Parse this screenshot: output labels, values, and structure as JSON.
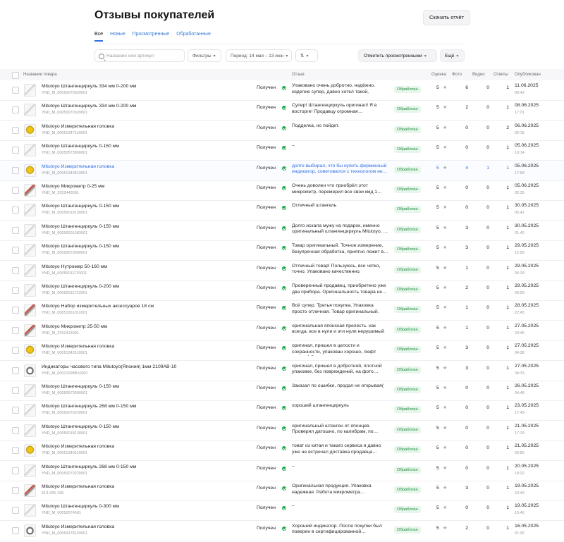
{
  "page": {
    "title": "Отзывы покупателей",
    "download_label": "Скачать отчёт",
    "tabs": [
      {
        "label": "Все",
        "active": true
      },
      {
        "label": "Новые",
        "active": false
      },
      {
        "label": "Просмотренные",
        "active": false
      },
      {
        "label": "Обработанные",
        "active": false
      }
    ]
  },
  "toolbar": {
    "search_placeholder": "Название или артикул",
    "filters_label": "Фильтры",
    "period_label": "Период: 14 мая – 13 июн",
    "mark_label": "Отметить просмотренными",
    "more_label": "Ещё"
  },
  "table": {
    "headers": {
      "product": "Название товара",
      "review": "Отзыв",
      "rating": "Оценка",
      "photo": "Фото",
      "video": "Видео",
      "answers": "Ответы",
      "published": "Опубликован"
    },
    "rows": [
      {
        "name": "Mitutoyo Штангенциркуль 334 мм 0-200 мм",
        "sku": "YND_M_00050070320001",
        "status": "Получен",
        "review": "Упаковано очень добротно, надёжно, изделие супер, давно хотел такой,",
        "badge": "Обработан",
        "rating": "5",
        "photo": "6",
        "video": "0",
        "answers": "1",
        "date": "11.06.2025",
        "time": "00:42",
        "thumb": "s"
      },
      {
        "name": "Mitutoyo Штангенциркуль 334 мм 0-200 мм",
        "sku": "YND_M_00050070320001",
        "status": "Получен",
        "review": "Супер! Штангенциркуль оригинал! Я в восторге! Продавцу огромная…",
        "badge": "Обработан",
        "rating": "5",
        "photo": "2",
        "video": "0",
        "answers": "1",
        "date": "08.06.2025",
        "time": "17:01",
        "thumb": "s"
      },
      {
        "name": "Mitutoyo Измерительная головка",
        "sku": "YND_M_00051347110001",
        "status": "Получен",
        "review": "Подделка, но пойдет.",
        "badge": "Обработан",
        "rating": "5",
        "photo": "0",
        "video": "0",
        "answers": "2",
        "date": "06.06.2025",
        "time": "02:18",
        "thumb": "y"
      },
      {
        "name": "Mitutoyo Штангенциркуль 0-150 мм",
        "sku": "YND_M_00050573000001",
        "status": "Получен",
        "review": "–",
        "badge": "Обработан",
        "rating": "5",
        "photo": "0",
        "video": "0",
        "answers": "1",
        "date": "05.06.2025",
        "time": "19:14",
        "thumb": "s"
      },
      {
        "name": "Mitutoyo Измерительная головка",
        "sku": "YND_M_00051340510001",
        "status": "Получен",
        "review": "долго выбирал, что бы купить фирменный индикатор, советовался с технологом не…",
        "badge": "Обработан",
        "rating": "5",
        "photo": "4",
        "video": "1",
        "answers": "1",
        "date": "05.06.2025",
        "time": "17:58",
        "thumb": "y",
        "hl": true
      },
      {
        "name": "Mitutoyo Микрометр 0-25 мм",
        "sku": "YND_M_2932443001",
        "status": "Получен",
        "review": "Очень доволен что приобрёл этот микрометр, перемерил все свои кмд 1…",
        "badge": "Обработан",
        "rating": "5",
        "photo": "0",
        "video": "0",
        "answers": "1",
        "date": "05.06.2025",
        "time": "02:35",
        "thumb": "r"
      },
      {
        "name": "Mitutoyo Штангенциркуль 0-150 мм",
        "sku": "YND_M_00050018130001",
        "status": "Получен",
        "review": "Отличный штангель",
        "badge": "Обработан",
        "rating": "5",
        "photo": "0",
        "video": "0",
        "answers": "1",
        "date": "30.05.2025",
        "time": "05:42",
        "thumb": "s"
      },
      {
        "name": "Mitutoyo Штангенциркуль 0-150 мм",
        "sku": "YND_M_00050001583001",
        "status": "Получен",
        "review": "Долго искала мужу на подарок, именно оригинальный штангенциркуль Mitutoyo, …",
        "badge": "Обработан",
        "rating": "5",
        "photo": "3",
        "video": "0",
        "answers": "1",
        "date": "30.05.2025",
        "time": "01:40",
        "thumb": "s"
      },
      {
        "name": "Mitutoyo Штангенциркуль 0-150 мм",
        "sku": "YND_M_00050573000001",
        "status": "Получен",
        "review": "Товар оригинальный. Точное измерение, безупречная обработка, приятно лежит в…",
        "badge": "Обработан",
        "rating": "5",
        "photo": "3",
        "video": "0",
        "answers": "1",
        "date": "29.05.2025",
        "time": "12:58",
        "thumb": "s"
      },
      {
        "name": "Mitutoyo Нутромер 50-160 мм",
        "sku": "YND_M_00050011170001",
        "status": "Получен",
        "review": "Отличный товар! Пользуюсь, все четко, точно. Упаковано качественно.",
        "badge": "Обработан",
        "rating": "5",
        "photo": "1",
        "video": "0",
        "answers": "1",
        "date": "29.05.2025",
        "time": "06:33",
        "thumb": "s"
      },
      {
        "name": "Mitutoyo Штангенциркуль 0-200 мм",
        "sku": "YND_M_00050011723001",
        "status": "Получен",
        "review": "Проверенный продавец, приобретено уже два прибора. Оригинальность товара не…",
        "badge": "Обработан",
        "rating": "5",
        "photo": "2",
        "video": "0",
        "answers": "1",
        "date": "29.05.2025",
        "time": "00:29",
        "thumb": "s"
      },
      {
        "name": "Mitutoyo Набор измерительных аксессуаров 18 см",
        "sku": "YND_M_00051561011001",
        "status": "Получен",
        "review": "Всё супер. Третья покупка. Упаковка просто отличная. Товар оригинальный.",
        "badge": "Обработан",
        "rating": "5",
        "photo": "1",
        "video": "0",
        "answers": "1",
        "date": "28.05.2025",
        "time": "22:45",
        "thumb": "r"
      },
      {
        "name": "Mitutoyo Микрометр 25-50 мм",
        "sku": "YND_M_2932413001",
        "status": "Получен",
        "review": "оригинальная японская прелесть. как всегда, все в нули и эти нули нерушимый (…",
        "badge": "Обработан",
        "rating": "5",
        "photo": "1",
        "video": "0",
        "answers": "1",
        "date": "27.05.2025",
        "time": "20:46",
        "thumb": "r"
      },
      {
        "name": "Mitutoyo Измерительная головка",
        "sku": "YND_M_00051340110001",
        "status": "Получен",
        "review": "оригинал, пришел в целости и сохранности, упакован хорошо, люфт менее 0.5 микрон…",
        "badge": "Обработан",
        "rating": "5",
        "photo": "3",
        "video": "0",
        "answers": "1",
        "date": "27.05.2025",
        "time": "04:38",
        "thumb": "y"
      },
      {
        "name": "Индикаторы часового типа Mitutoyo(Япония) 1мм 2109AB-10",
        "sku": "YND_M_00021098B10001",
        "status": "Получен",
        "review": "оригинал, пришел в добротной, плотной упаковке, без повреждений, на фото…",
        "badge": "Обработан",
        "rating": "5",
        "photo": "3",
        "video": "0",
        "answers": "1",
        "date": "27.05.2025",
        "time": "04:33",
        "thumb": "d"
      },
      {
        "name": "Mitutoyo Штангенциркуль 0-150 мм",
        "sku": "YND_M_00050573000001",
        "status": "Получен",
        "review": "Заказал по ошибке, продал не открывая(",
        "badge": "Обработан",
        "rating": "5",
        "photo": "0",
        "video": "0",
        "answers": "1",
        "date": "26.05.2025",
        "time": "04:48",
        "thumb": "s"
      },
      {
        "name": "Mitutoyo Штангенциркуль 268 мм 0-150 мм",
        "sku": "YND_M_00050070220001",
        "status": "Получен",
        "review": "хороший штангенциркуль",
        "badge": "Обработан",
        "rating": "5",
        "photo": "0",
        "video": "0",
        "answers": "1",
        "date": "23.05.2025",
        "time": "17:43",
        "thumb": "s"
      },
      {
        "name": "Mitutoyo Штангенциркуль 0-150 мм",
        "sku": "YND_M_00050018130001",
        "status": "Получен",
        "review": "оригинальный штанген от японцев. Проверял датошно, по калибрам, по…",
        "badge": "Обработан",
        "rating": "5",
        "photo": "0",
        "video": "0",
        "answers": "1",
        "date": "21.05.2025",
        "time": "17:33",
        "thumb": "s"
      },
      {
        "name": "Mitutoyo Измерительная головка",
        "sku": "YND_M_00051340110001",
        "status": "Получен",
        "review": "товат из китая и такаго сервиса я давно уже не встречал доставка продавца…",
        "badge": "Обработан",
        "rating": "5",
        "photo": "0",
        "video": "0",
        "answers": "1",
        "date": "21.05.2025",
        "time": "03:56",
        "thumb": "y"
      },
      {
        "name": "Mitutoyo Штангенциркуль 268 мм 0-150 мм",
        "sku": "YND_M_00050070220001",
        "status": "Получен",
        "review": "–",
        "badge": "Обработан",
        "rating": "5",
        "photo": "0",
        "video": "0",
        "answers": "1",
        "date": "20.05.2025",
        "time": "18:32",
        "thumb": "s"
      },
      {
        "name": "Mitutoyo Измерительная головка",
        "sku": "513-426-10E",
        "status": "Получен",
        "review": "Оригинальная продукция. Упаковка надежная. Работа микрометра…",
        "badge": "Обработан",
        "rating": "5",
        "photo": "3",
        "video": "0",
        "answers": "1",
        "date": "19.05.2025",
        "time": "23:49",
        "thumb": "r"
      },
      {
        "name": "Mitutoyo Штангенциркуль 0-300 мм",
        "sku": "YND_M_00050574601",
        "status": "Получен",
        "review": "–",
        "badge": "Обработан",
        "rating": "5",
        "photo": "0",
        "video": "0",
        "answers": "1",
        "date": "19.05.2025",
        "time": "15:46",
        "thumb": "s"
      },
      {
        "name": "Mitutoyo Измерительная головка",
        "sku": "YND_M_00054378150001",
        "status": "Получен",
        "review": "Хороший индикатор. После покупки был поверен в сертифицированной…",
        "badge": "Обработан",
        "rating": "5",
        "photo": "2",
        "video": "0",
        "answers": "1",
        "date": "16.05.2025",
        "time": "01:06",
        "thumb": "d"
      }
    ]
  }
}
